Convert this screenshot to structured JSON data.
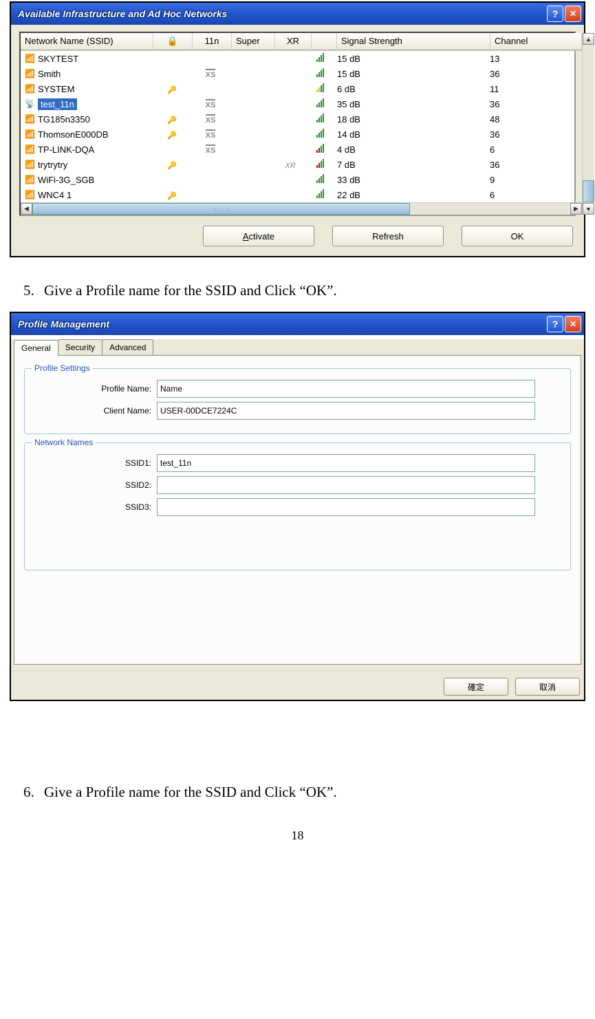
{
  "page_number": "18",
  "steps": {
    "s5": {
      "num": "5.",
      "text": "Give a Profile name for the SSID and Click “OK”."
    },
    "s6": {
      "num": "6.",
      "text": "Give a Profile name for the SSID and Click “OK”."
    }
  },
  "win1": {
    "title": "Available Infrastructure and Ad Hoc Networks",
    "headers": {
      "ssid": "Network Name (SSID)",
      "sec": "🔒",
      "n11": "11n",
      "super": "Super",
      "xr": "XR",
      "signal": "Signal Strength",
      "channel": "Channel"
    },
    "rows": [
      {
        "ssid": "SKYTEST",
        "sec": "",
        "xs": "",
        "xr": "",
        "sig": "15 dB",
        "ch": "13",
        "lvl": "hi",
        "sel": false
      },
      {
        "ssid": "Smith",
        "sec": "",
        "xs": "XS",
        "xr": "",
        "sig": "15 dB",
        "ch": "36",
        "lvl": "hi",
        "sel": false
      },
      {
        "ssid": "SYSTEM",
        "sec": "🔑",
        "xs": "",
        "xr": "",
        "sig": "6 dB",
        "ch": "11",
        "lvl": "med",
        "sel": false
      },
      {
        "ssid": "test_11n",
        "sec": "",
        "xs": "XS",
        "xr": "",
        "sig": "35 dB",
        "ch": "36",
        "lvl": "hi",
        "sel": true
      },
      {
        "ssid": "TG185n3350",
        "sec": "🔑",
        "xs": "XS",
        "xr": "",
        "sig": "18 dB",
        "ch": "48",
        "lvl": "hi",
        "sel": false
      },
      {
        "ssid": "ThomsonE000DB",
        "sec": "🔑",
        "xs": "XS",
        "xr": "",
        "sig": "14 dB",
        "ch": "36",
        "lvl": "hi",
        "sel": false
      },
      {
        "ssid": "TP-LINK-DQA",
        "sec": "",
        "xs": "XS",
        "xr": "",
        "sig": "4 dB",
        "ch": "6",
        "lvl": "low",
        "sel": false
      },
      {
        "ssid": "trytrytry",
        "sec": "🔑",
        "xs": "",
        "xr": "XR",
        "sig": "7 dB",
        "ch": "36",
        "lvl": "low",
        "sel": false
      },
      {
        "ssid": "WiFi-3G_SGB",
        "sec": "",
        "xs": "",
        "xr": "",
        "sig": "33 dB",
        "ch": "9",
        "lvl": "hi",
        "sel": false
      },
      {
        "ssid": "WNC4 1",
        "sec": "🔑",
        "xs": "",
        "xr": "",
        "sig": "22 dB",
        "ch": "6",
        "lvl": "hi",
        "sel": false
      }
    ],
    "buttons": {
      "activate": "Activate",
      "refresh": "Refresh",
      "ok": "OK"
    }
  },
  "win2": {
    "title": "Profile Management",
    "tabs": {
      "general": "General",
      "security": "Security",
      "advanced": "Advanced"
    },
    "profile_settings_legend": "Profile Settings",
    "network_names_legend": "Network Names",
    "labels": {
      "profile_name": "Profile Name:",
      "client_name": "Client Name:",
      "ssid1": "SSID1:",
      "ssid2": "SSID2:",
      "ssid3": "SSID3:"
    },
    "values": {
      "profile_name": "Name",
      "client_name": "USER-00DCE7224C",
      "ssid1": "test_11n",
      "ssid2": "",
      "ssid3": ""
    },
    "buttons": {
      "ok": "確定",
      "cancel": "取消"
    }
  }
}
